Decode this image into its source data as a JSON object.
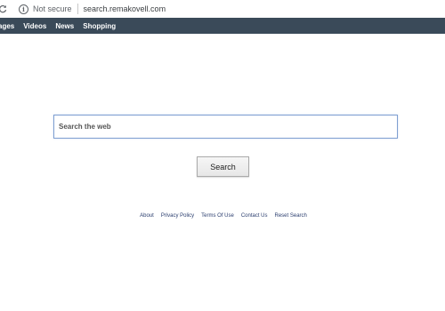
{
  "browser": {
    "security_label": "Not secure",
    "url": "search.remakovell.com"
  },
  "nav": {
    "items": [
      "ages",
      "Videos",
      "News",
      "Shopping"
    ]
  },
  "search": {
    "placeholder": "Search the web",
    "button_label": "Search"
  },
  "footer": {
    "links": [
      "About",
      "Privacy Policy",
      "Terms Of Use",
      "Contact Us",
      "Reset Search"
    ]
  },
  "colors": {
    "navbar_bg": "#3a4a59",
    "input_border": "#7f9fd1",
    "footer_link": "#2a3d6e"
  }
}
